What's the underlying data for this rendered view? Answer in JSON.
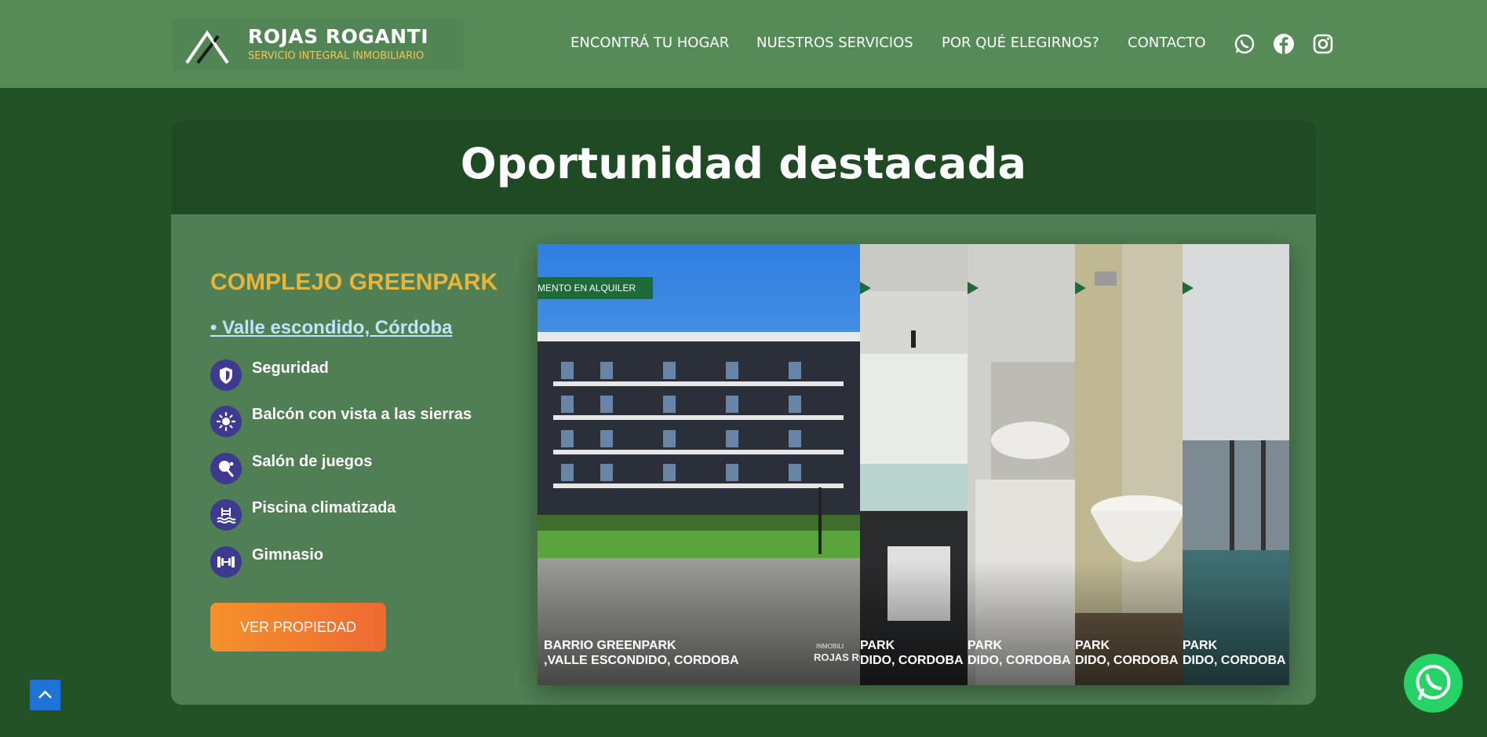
{
  "brand": {
    "name": "ROJAS ROGANTI",
    "tagline": "SERVICIO INTEGRAL INMOBILIARIO"
  },
  "nav": {
    "items": [
      {
        "label": "ENCONTRÁ TU HOGAR"
      },
      {
        "label": "NUESTROS SERVICIOS"
      },
      {
        "label": "POR QUÉ ELEGIRNOS?"
      },
      {
        "label": "CONTACTO"
      }
    ],
    "social": [
      "whatsapp-icon",
      "facebook-icon",
      "instagram-icon"
    ]
  },
  "featured": {
    "heading": "Oportunidad destacada",
    "property_name": "COMPLEJO GREENPARK",
    "location": "• Valle escondido, Córdoba",
    "features": [
      {
        "label": "Seguridad",
        "icon": "shield-icon"
      },
      {
        "label": "Balcón con vista a las sierras",
        "icon": "sun-icon"
      },
      {
        "label": "Salón de juegos",
        "icon": "ping-pong-icon"
      },
      {
        "label": "Piscina climatizada",
        "icon": "pool-icon"
      },
      {
        "label": "Gimnasio",
        "icon": "dumbbell-icon"
      }
    ],
    "cta_label": "VER PROPIEDAD"
  },
  "gallery": {
    "main_tag": "MENTO EN ALQUILER",
    "main_caption_1": "BARRIO GREENPARK",
    "main_caption_2": ",VALLE ESCONDIDO, CORDOBA",
    "watermark_small": "INMOBILI",
    "watermark_brand": "ROJAS RO",
    "panel_caption_1": "PARK",
    "panel_caption_2": "DIDO, CORDOBA"
  },
  "colors": {
    "header_bg": "#558b57",
    "page_bg": "#235226",
    "card_bg": "#4f7f53",
    "accent_gold": "#e8b53a",
    "cta_orange": "#f5912a",
    "feature_icon_bg": "#3d3a8f",
    "whatsapp_green": "#25d366"
  }
}
